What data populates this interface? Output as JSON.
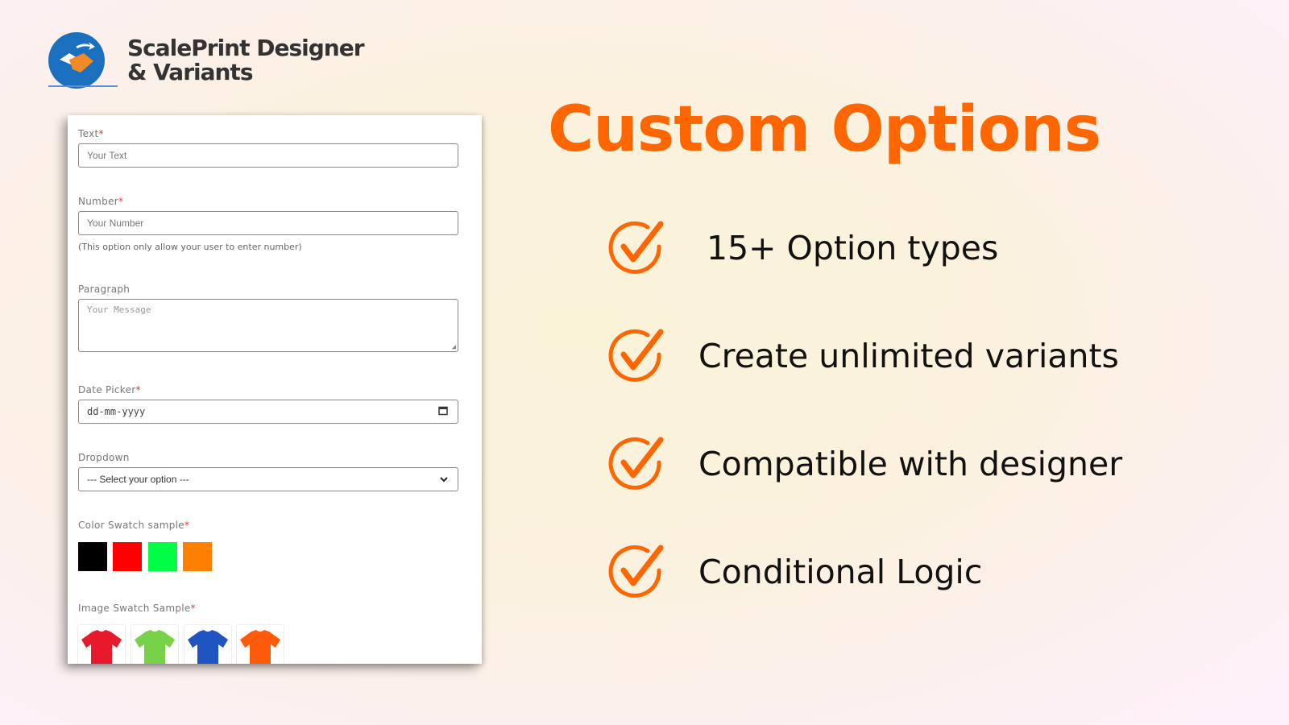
{
  "brand": {
    "name_line1": "ScalePrint Designer",
    "name_line2": "& Variants",
    "logo_icon": "handshake-icon",
    "logo_color": "#1b6fbf"
  },
  "form": {
    "text": {
      "label": "Text",
      "required_mark": "*",
      "placeholder": "Your Text"
    },
    "number": {
      "label": "Number",
      "required_mark": "*",
      "placeholder": "Your Number",
      "hint": "(This option only allow your user to enter number)"
    },
    "paragraph": {
      "label": "Paragraph",
      "placeholder": "Your Message"
    },
    "date": {
      "label": "Date Picker",
      "required_mark": "*",
      "placeholder": "dd-mm-yyyy",
      "icon": "calendar-icon"
    },
    "dropdown": {
      "label": "Dropdown",
      "selected": "--- Select your option ---",
      "icon": "chevron-down-icon"
    },
    "color_swatch": {
      "label": "Color Swatch sample",
      "required_mark": "*",
      "colors": [
        "#000000",
        "#ff0000",
        "#00ff44",
        "#ff7f00"
      ]
    },
    "image_swatch": {
      "label": "Image Swatch Sample",
      "required_mark": "*",
      "tees": [
        "#e8192c",
        "#77d24a",
        "#1f55c0",
        "#ff5a0a"
      ]
    }
  },
  "heading": "Custom Options",
  "accent_color": "#ff6600",
  "features": [
    {
      "label": "15+ Option types",
      "icon": "check-circle-icon"
    },
    {
      "label": "Create unlimited variants",
      "icon": "check-circle-icon"
    },
    {
      "label": "Compatible with designer",
      "icon": "check-circle-icon"
    },
    {
      "label": "Conditional Logic",
      "icon": "check-circle-icon"
    }
  ]
}
